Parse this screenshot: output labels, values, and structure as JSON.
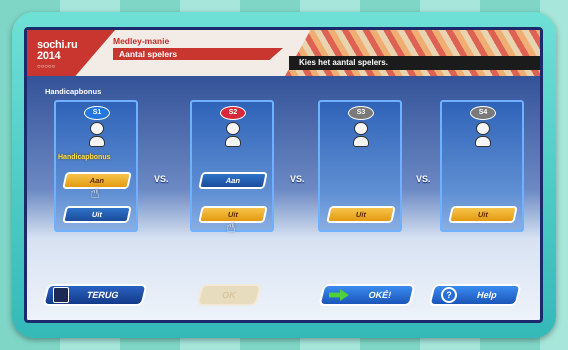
{
  "header": {
    "logo": {
      "line1": "sochi.ru",
      "line2": "2014",
      "rings": "○○○○○"
    },
    "title": "Medley-manie",
    "subtitle": "Aantal spelers",
    "instruction": "Kies het aantal spelers."
  },
  "section_label": "Handicapbonus",
  "players": [
    {
      "tag": "S1",
      "bubble_color": "#2277e0",
      "handicap_label": "Handicapbonus",
      "on_label": "Aan",
      "off_label": "Uit",
      "selected": "on"
    },
    {
      "tag": "S2",
      "bubble_color": "#d8283a",
      "on_label": "Aan",
      "off_label": "Uit",
      "selected": "off"
    },
    {
      "tag": "S3",
      "bubble_color": "#7a7a7a",
      "off_label": "Uit"
    },
    {
      "tag": "S4",
      "bubble_color": "#7a7a7a",
      "off_label": "Uit"
    }
  ],
  "vs_label": "VS.",
  "bottom": {
    "back_label": "TERUG",
    "disabled_label": "OK",
    "ok_label": "OKÉ!",
    "help_label": "Help",
    "help_icon_glyph": "?"
  },
  "colors": {
    "brand_red": "#c9352f",
    "selected_orange": "#e39a12",
    "button_blue": "#1b4b9b"
  }
}
